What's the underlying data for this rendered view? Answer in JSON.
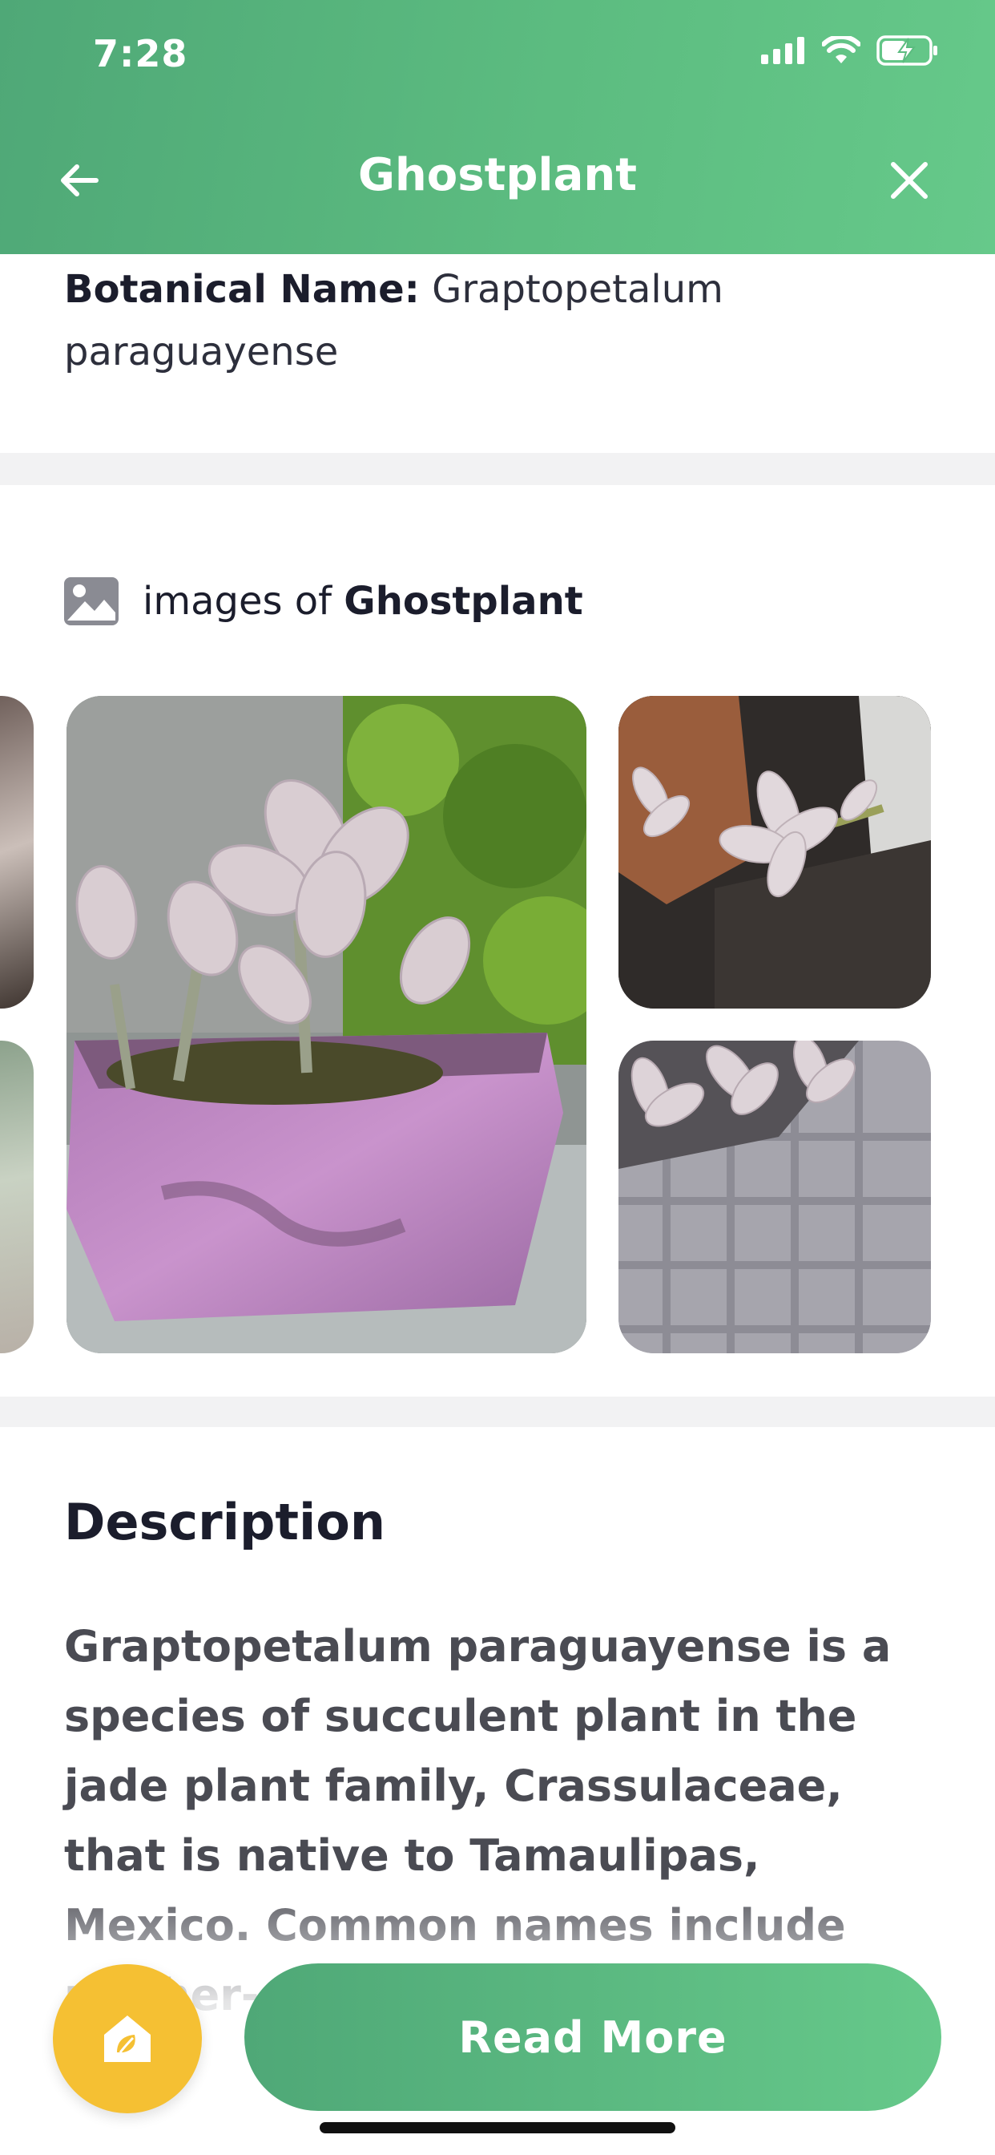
{
  "status_bar": {
    "time": "7:28"
  },
  "header": {
    "title": "Ghostplant"
  },
  "botanical": {
    "label": "Botanical Name:",
    "value": " Graptopetalum paraguayense"
  },
  "images": {
    "prefix": "images of ",
    "plant_name": "Ghostplant"
  },
  "description": {
    "title": "Description",
    "text": "Graptopetalum paraguayense is a species of succulent plant in the jade plant family, Crassulaceae, that is native to Tamaulipas, Mexico. Common names include mother-"
  },
  "footer": {
    "read_more": "Read More"
  },
  "colors": {
    "brand_green": "#5cbc80",
    "accent_yellow": "#f5c033"
  }
}
